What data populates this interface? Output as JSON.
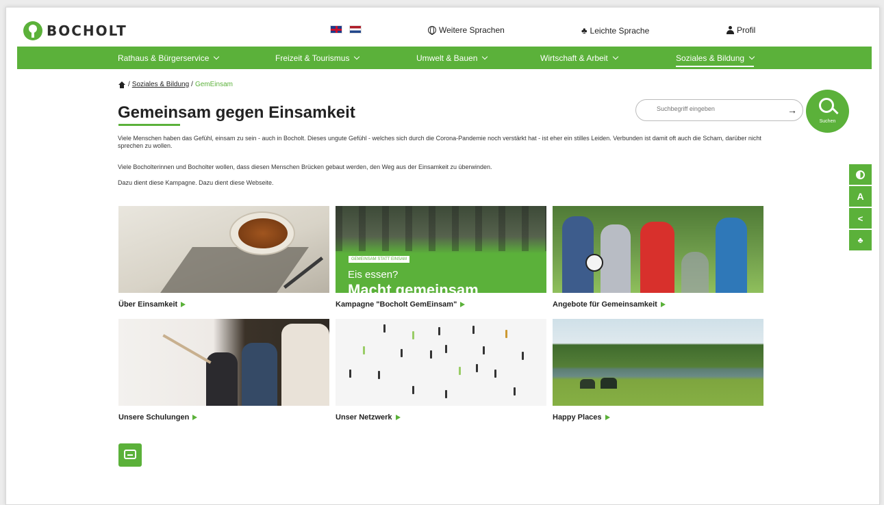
{
  "header": {
    "logo_text": "BOCHOLT",
    "more_languages": "Weitere Sprachen",
    "easy_language": "Leichte Sprache",
    "profile": "Profil"
  },
  "nav": {
    "items": [
      {
        "label": "Rathaus & Bürgerservice"
      },
      {
        "label": "Freizeit & Tourismus"
      },
      {
        "label": "Umwelt & Bauen"
      },
      {
        "label": "Wirtschaft & Arbeit"
      },
      {
        "label": "Soziales & Bildung"
      }
    ]
  },
  "breadcrumb": {
    "parent": "Soziales & Bildung",
    "current": "GemEinsam"
  },
  "page": {
    "title": "Gemeinsam gegen Einsamkeit",
    "p1": "Viele Menschen haben das Gefühl, einsam zu sein - auch in Bocholt. Dieses ungute Gefühl - welches sich durch die Corona-Pandemie noch verstärkt hat - ist eher ein stilles Leiden. Verbunden ist damit oft auch die Scham, darüber nicht sprechen zu wollen.",
    "p2": "Viele Bocholterinnen und Bocholter wollen, dass diesen Menschen Brücken gebaut werden, den Weg aus der Einsamkeit zu überwinden.",
    "p3": "Dazu dient diese Kampagne. Dazu dient diese Webseite."
  },
  "search": {
    "placeholder": "Suchbegriff eingeben",
    "button_label": "Suchen"
  },
  "cards": [
    {
      "caption": "Über Einsamkeit"
    },
    {
      "caption": "Kampagne \"Bocholt GemEinsam\"",
      "tag": "GEMEINSAM STATT EINSAM",
      "overlay1": "Eis essen?",
      "overlay2": "Macht gemeinsam"
    },
    {
      "caption": "Angebote für Gemeinsamkeit"
    },
    {
      "caption": "Unsere Schulungen"
    },
    {
      "caption": "Unser Netzwerk"
    },
    {
      "caption": "Happy Places"
    }
  ],
  "colors": {
    "brand_green": "#5bb13a"
  }
}
